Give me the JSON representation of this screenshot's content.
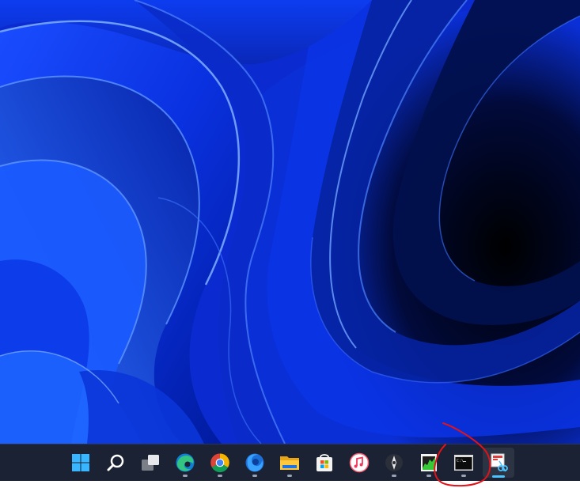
{
  "desktop": {
    "wallpaper": "windows-11-bloom-blue",
    "colors": {
      "deep": "#000a3c",
      "mid": "#0a2fd6",
      "bright": "#2f6bff",
      "highlight": "#7fb0ff"
    }
  },
  "taskbar": {
    "background": "#1b2233",
    "items": [
      {
        "icon": "windows-start-icon",
        "running": false
      },
      {
        "icon": "search-icon",
        "running": false
      },
      {
        "icon": "task-view-icon",
        "running": false
      },
      {
        "icon": "edge-icon",
        "running": true
      },
      {
        "icon": "chrome-icon",
        "running": true
      },
      {
        "icon": "firefox-icon",
        "running": true
      },
      {
        "icon": "file-explorer-icon",
        "running": true
      },
      {
        "icon": "microsoft-store-icon",
        "running": false
      },
      {
        "icon": "itunes-icon",
        "running": false
      },
      {
        "icon": "app-icon",
        "running": true
      },
      {
        "icon": "system-monitor-icon",
        "running": true
      },
      {
        "icon": "command-prompt-icon",
        "running": true,
        "annotated": true
      },
      {
        "icon": "snipping-tool-icon",
        "running": true,
        "active": true
      }
    ]
  },
  "annotation": {
    "type": "freehand-circle",
    "color": "#e0131a",
    "target": "command-prompt-icon"
  }
}
